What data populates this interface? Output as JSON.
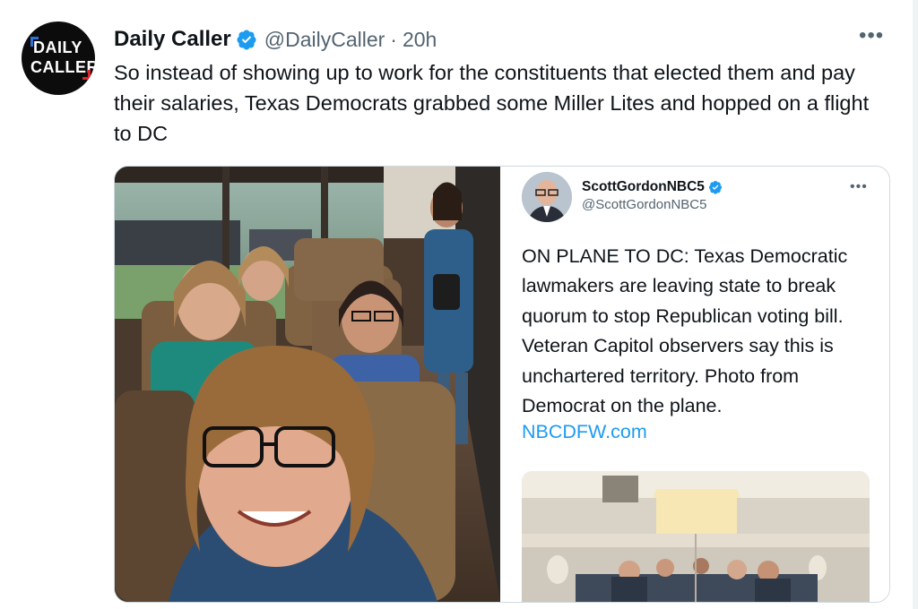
{
  "tweet": {
    "author_name": "Daily Caller",
    "handle": "@DailyCaller",
    "separator": "·",
    "time": "20h",
    "more": "•••",
    "text": "So instead of showing up to work for the constituents that elected them and pay their salaries, Texas Democrats grabbed some Miller Lites and hopped on a flight to DC",
    "avatar": {
      "line1": "DAILY",
      "line2": "CALLER"
    }
  },
  "quoted_tweet": {
    "author_name": "ScottGordonNBC5",
    "handle": "@ScottGordonNBC5",
    "more": "•••",
    "text": "ON PLANE TO DC: Texas Democratic lawmakers are leaving state to break quorum to stop Republican voting bill. Veteran Capitol observers say this is unchartered territory. Photo from Democrat on the plane.",
    "link": "NBCDFW.com"
  },
  "colors": {
    "verified": "#1d9bf0",
    "link": "#1d9bf0",
    "secondary_text": "#536471",
    "brand_blue": "#2f6fd6",
    "brand_red": "#e0252b"
  },
  "icons": {
    "verified": "verified-badge-icon",
    "more": "more-options-icon"
  }
}
